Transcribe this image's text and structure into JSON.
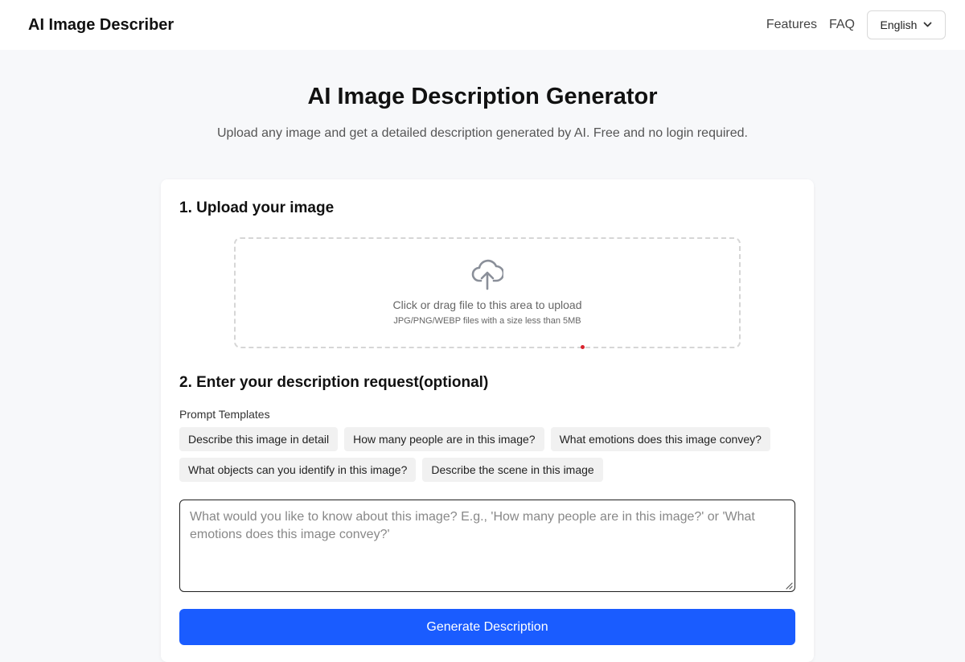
{
  "header": {
    "brand": "AI Image Describer",
    "nav": {
      "features": "Features",
      "faq": "FAQ"
    },
    "language": {
      "selected": "English",
      "icon": "chevron-down-icon"
    }
  },
  "hero": {
    "title": "AI Image Description Generator",
    "subtitle": "Upload any image and get a detailed description generated by AI. Free and no login required."
  },
  "upload": {
    "step_title": "1. Upload your image",
    "icon": "cloud-upload-icon",
    "main_text": "Click or drag file to this area to upload",
    "hint_text": "JPG/PNG/WEBP files with a size less than 5MB"
  },
  "request": {
    "step_title": "2. Enter your description request(optional)",
    "templates_label": "Prompt Templates",
    "templates": [
      "Describe this image in detail",
      "How many people are in this image?",
      "What emotions does this image convey?",
      "What objects can you identify in this image?",
      "Describe the scene in this image"
    ],
    "textarea": {
      "value": "",
      "placeholder": "What would you like to know about this image? E.g., 'How many people are in this image?' or 'What emotions does this image convey?'"
    },
    "generate_label": "Generate Description"
  },
  "colors": {
    "primary": "#1a5cff",
    "chip_bg": "#f1f1f1",
    "page_bg": "#f7f8fa",
    "dot": "#d9232d"
  }
}
